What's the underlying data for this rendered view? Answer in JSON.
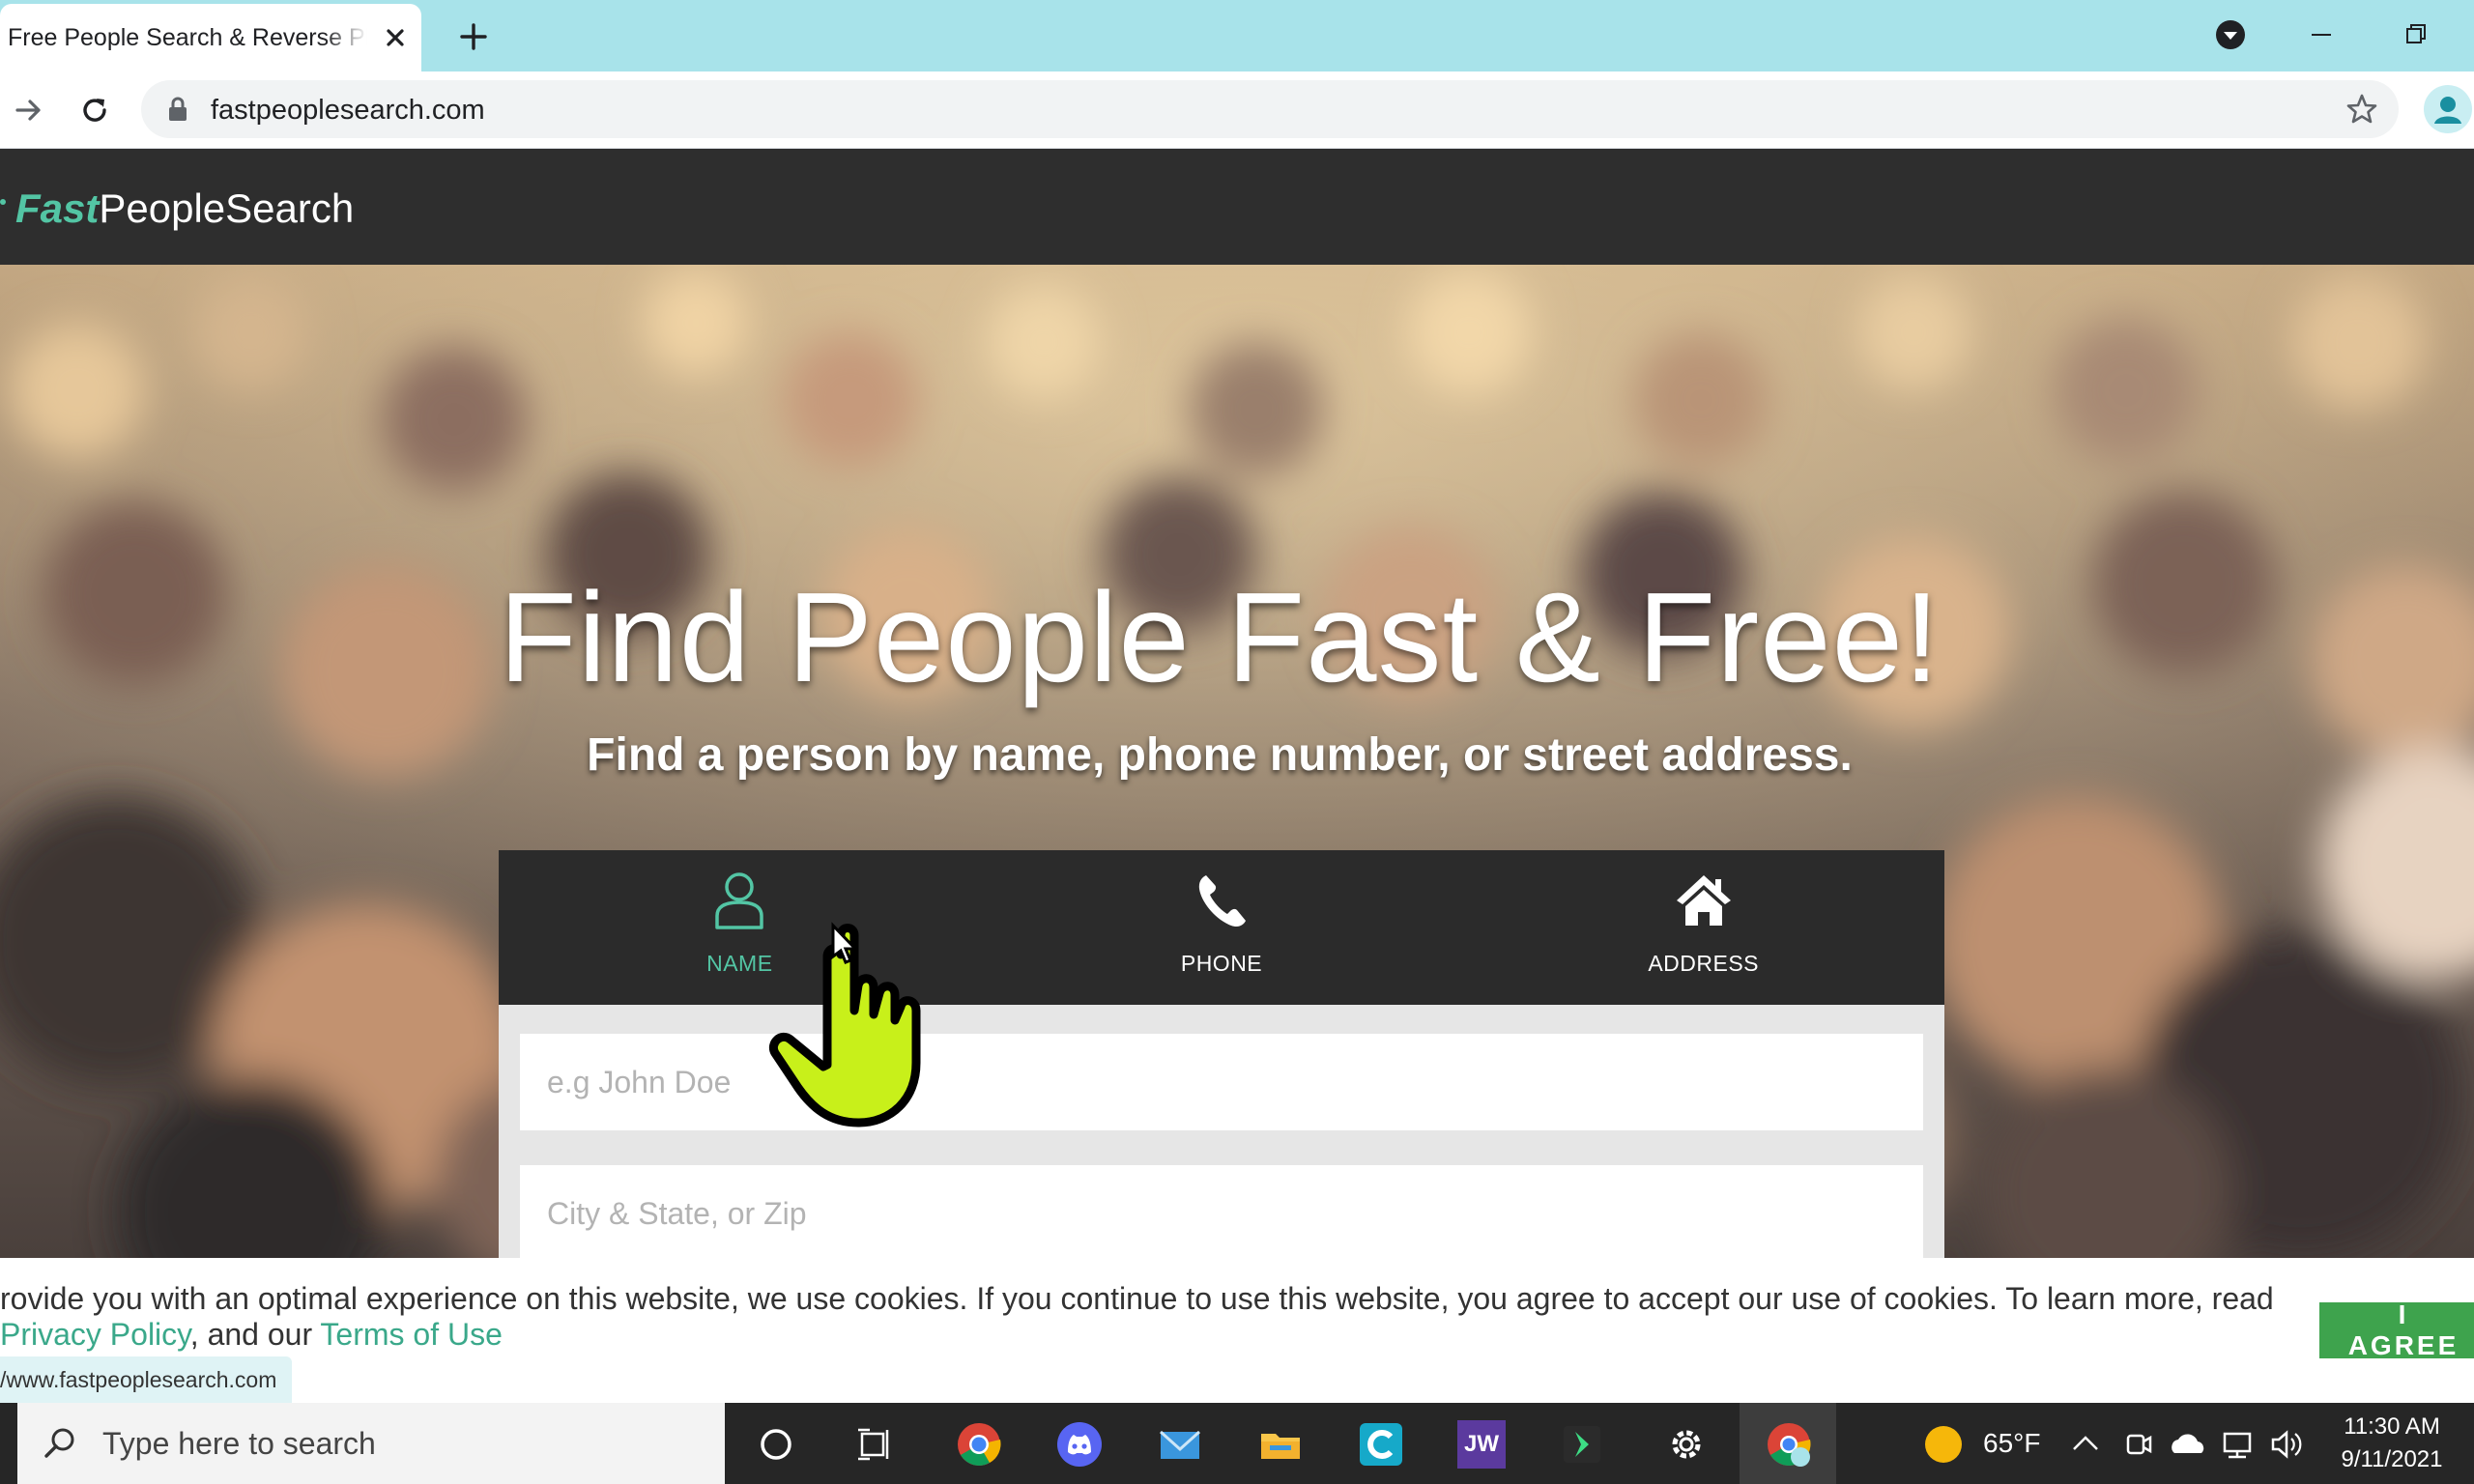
{
  "browser": {
    "tab_title": "Free People Search & Reverse Phone Lookup",
    "url": "fastpeoplesearch.com"
  },
  "site": {
    "logo_fast": "Fast",
    "logo_rest": "PeopleSearch",
    "accent_color": "#53c5a4"
  },
  "hero": {
    "title": "Find People Fast & Free!",
    "subtitle": "Find a person by name, phone number, or street address."
  },
  "search": {
    "tabs": [
      {
        "label": "NAME",
        "icon": "person-icon",
        "active": true
      },
      {
        "label": "PHONE",
        "icon": "phone-icon",
        "active": false
      },
      {
        "label": "ADDRESS",
        "icon": "house-icon",
        "active": false
      }
    ],
    "name_placeholder": "e.g John Doe",
    "location_placeholder": "City & State, or Zip"
  },
  "cookie": {
    "text_before": "rovide you with an optimal experience on this website, we use cookies. If you continue to use this website, you agree to accept our use of cookies. To learn more, read",
    "privacy_link": "Privacy Policy",
    "text_middle": ", and our ",
    "terms_link": "Terms of Use",
    "agree_label": "I AGREE",
    "agree_color": "#3ea34d"
  },
  "status_bar": {
    "url": "/www.fastpeoplesearch.com"
  },
  "taskbar": {
    "search_placeholder": "Type here to search",
    "weather": "65°F",
    "time": "11:30 AM",
    "date": "9/11/2021",
    "apps": [
      "cortana-icon",
      "task-view-icon",
      "chrome-icon",
      "discord-icon",
      "mail-icon",
      "file-explorer-icon",
      "c-app-icon",
      "jw-icon",
      "arrow-app-icon",
      "settings-icon",
      "chrome-profile-icon"
    ],
    "jw_label": "JW"
  }
}
